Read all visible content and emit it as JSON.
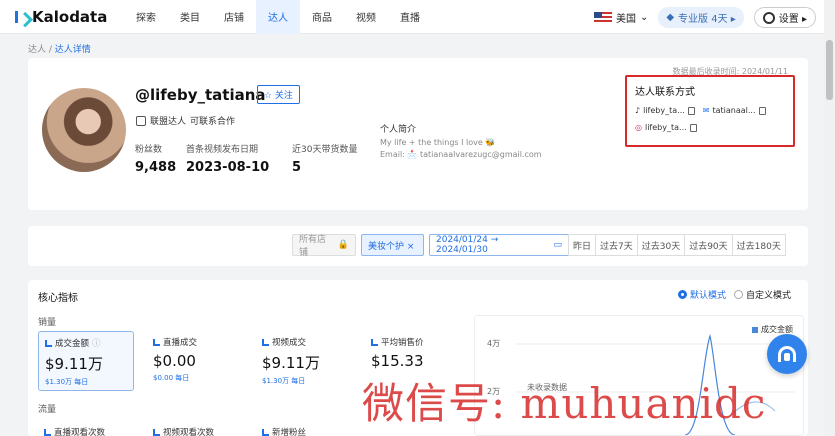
{
  "nav": {
    "logo": "Kalodata",
    "items": [
      "探索",
      "类目",
      "店铺",
      "达人",
      "商品",
      "视频",
      "直播"
    ],
    "active_index": 3,
    "country": "美国",
    "plan": "专业版 4天 ▸",
    "settings": "设置 ▸"
  },
  "breadcrumb": {
    "parent": "达人",
    "separator": " / ",
    "current": "达人详情"
  },
  "profile": {
    "update_time": "数据最后收录时间: 2024/01/11",
    "handle": "@lifeby_tatiana",
    "follow_label": "☆ 关注",
    "affiliate_label": "联盟达人",
    "affiliate_status": "可联系合作",
    "stats": [
      {
        "label": "粉丝数",
        "value": "9,488"
      },
      {
        "label": "首条视频发布日期",
        "value": "2023-08-10"
      },
      {
        "label": "近30天带货数量",
        "value": "5"
      }
    ],
    "bio_label": "个人简介",
    "bio_text": "My life + the things I love 🐝",
    "bio_email": "Email: 📩 tatianaalvarezugc@gmail.com"
  },
  "contact": {
    "title": "达人联系方式",
    "tiktok": "lifeby_ta...",
    "email": "tatianaal...",
    "instagram": "lifeby_ta..."
  },
  "filters": {
    "shop": "所有店铺",
    "tag": "美妆个护 ×",
    "date": "2024/01/24 → 2024/01/30",
    "ranges": [
      "昨日",
      "过去7天",
      "过去30天",
      "过去90天",
      "过去180天"
    ]
  },
  "metrics": {
    "title": "核心指标",
    "mode_default": "默认模式",
    "mode_custom": "自定义模式",
    "sales_label": "销量",
    "traffic_label": "流量",
    "items": [
      {
        "label": "成交金额",
        "value": "$9.11万",
        "sub": "$1.30万 每日"
      },
      {
        "label": "直播成交",
        "value": "$0.00",
        "sub": "$0.00 每日"
      },
      {
        "label": "视频成交",
        "value": "$9.11万",
        "sub": "$1.30万 每日"
      },
      {
        "label": "平均销售价",
        "value": "$15.33",
        "sub": ""
      }
    ],
    "traffic_items": [
      "直播观看次数",
      "视频观看次数",
      "新增粉丝"
    ]
  },
  "chart": {
    "legend": "成交金额",
    "ticks": [
      "4万",
      "2万"
    ],
    "no_data": "未收录数据"
  },
  "watermark": "微信号: muhuanidc"
}
